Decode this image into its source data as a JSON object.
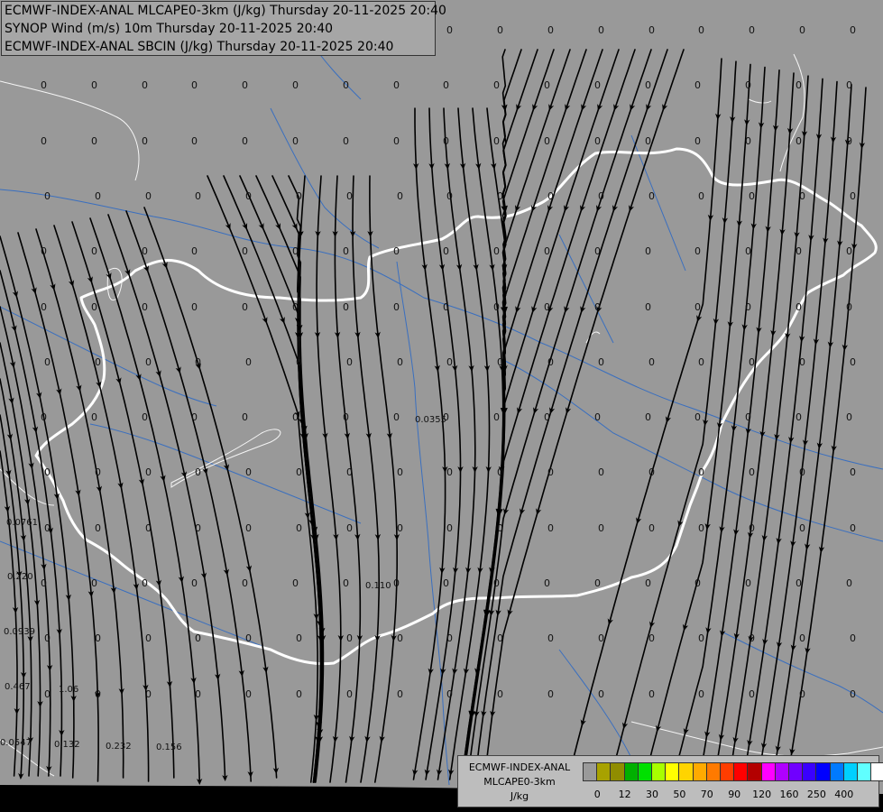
{
  "header": {
    "line1": "ECMWF-INDEX-ANAL MLCAPE0-3km (J/kg) Thursday 20-11-2025 20:40",
    "line2": "SYNOP Wind (m/s) 10m Thursday 20-11-2025 20:40",
    "line3": "ECMWF-INDEX-ANAL SBCIN (J/kg) Thursday 20-11-2025 20:40"
  },
  "legend": {
    "title1": "ECMWF-INDEX-ANAL",
    "title2": "MLCAPE0-3km",
    "title3": "J/kg",
    "colors": [
      "#9a9a9a",
      "#a8a200",
      "#908d00",
      "#00b000",
      "#00e000",
      "#a8ff00",
      "#ffff00",
      "#ffd400",
      "#ffaa00",
      "#ff7a00",
      "#ff3d00",
      "#ff0000",
      "#b30000",
      "#ff00ff",
      "#b000ff",
      "#7000ff",
      "#3a00ff",
      "#0000ff",
      "#007aff",
      "#00d0ff",
      "#60ffff",
      "#ffffff"
    ],
    "ticks": [
      "0",
      "12",
      "30",
      "50",
      "70",
      "90",
      "120",
      "160",
      "250",
      "400"
    ]
  },
  "map_values": {
    "zero": "0",
    "labels": [
      "0.0355",
      "0.110",
      "0.0761",
      "0.220",
      "0.0939",
      "0.467",
      "1.06",
      "0.0547",
      "0.132",
      "0.232",
      "0.156"
    ]
  },
  "colors": {
    "background": "#999999",
    "border": "#ffffff",
    "rivers": "#3a6fbf",
    "streamlines": "#000000"
  }
}
